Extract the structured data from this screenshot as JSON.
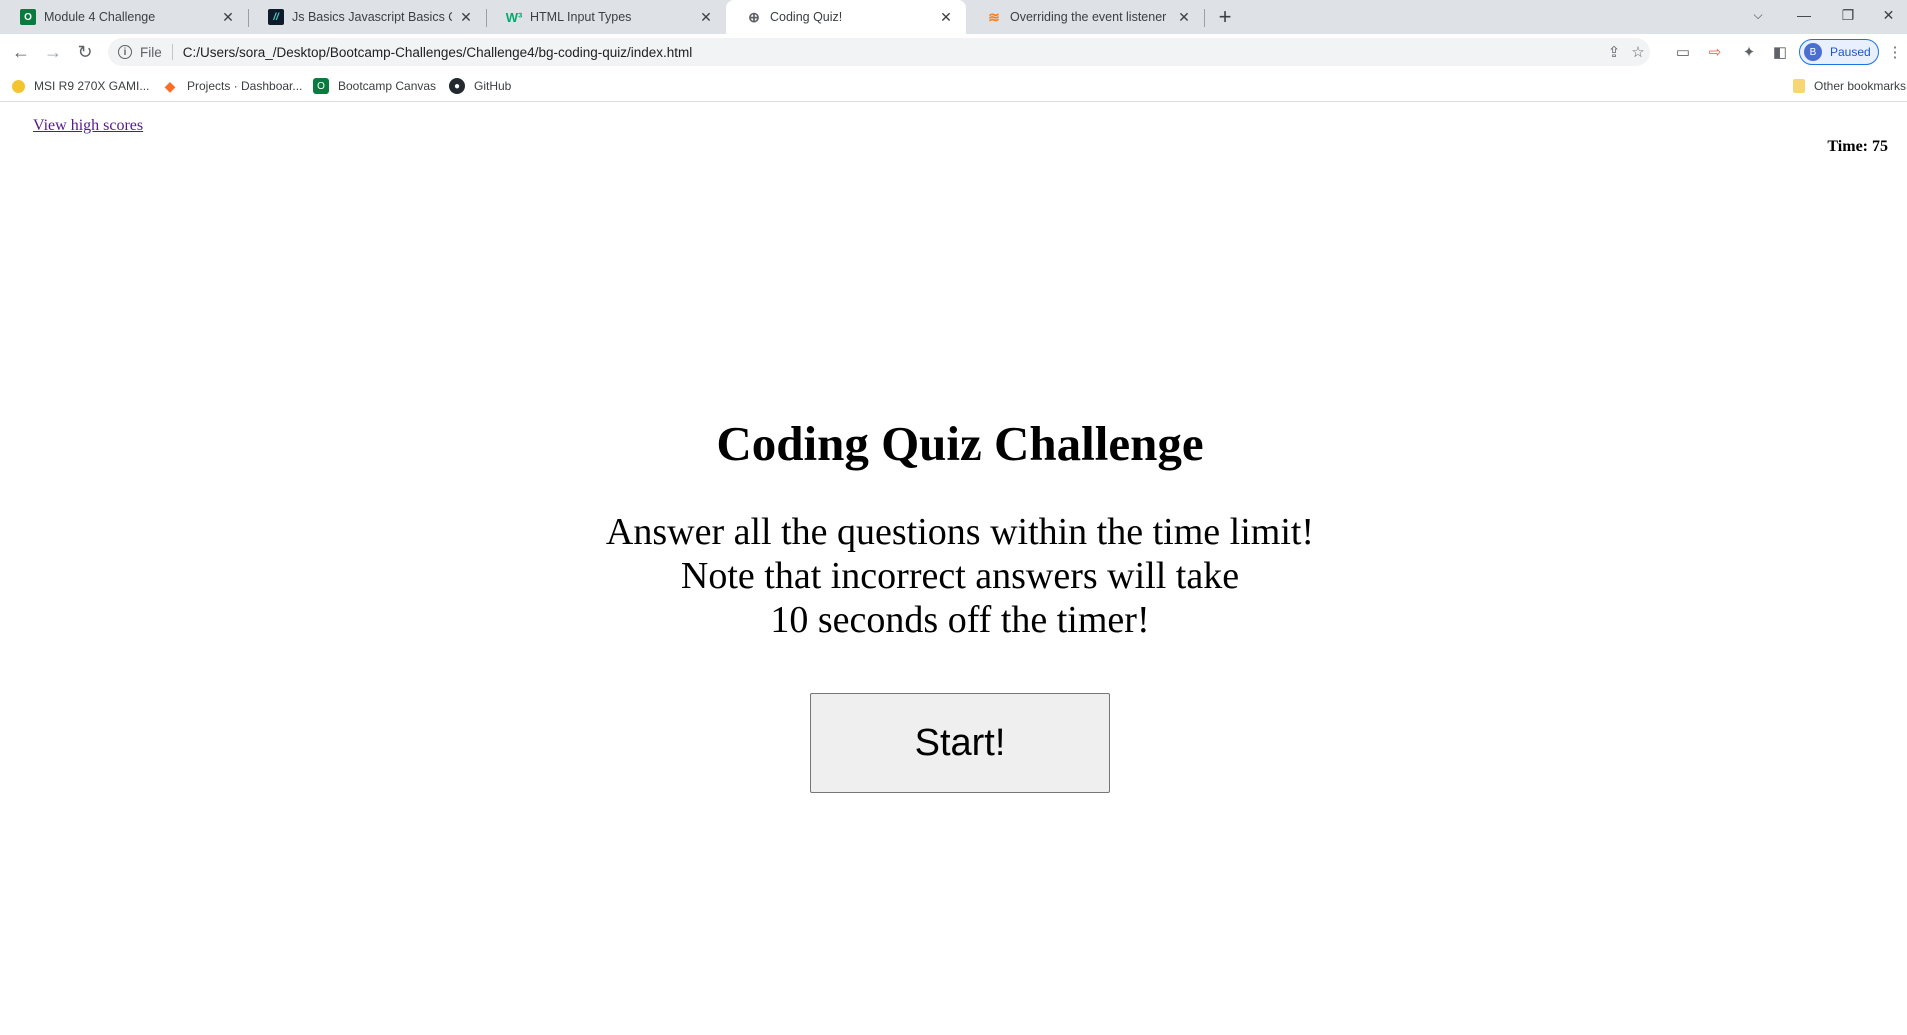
{
  "browser": {
    "tabs": [
      {
        "title": "Module 4 Challenge",
        "icon": "canvas-icon",
        "active": false
      },
      {
        "title": "Js Basics Javascript Basics Quiz -",
        "icon": "quiz-icon",
        "active": false
      },
      {
        "title": "HTML Input Types",
        "icon": "w3schools-icon",
        "active": false
      },
      {
        "title": "Coding Quiz!",
        "icon": "globe-icon",
        "active": true
      },
      {
        "title": "Overriding the event listener in ja",
        "icon": "stackoverflow-icon",
        "active": false
      }
    ],
    "address": {
      "scheme": "File",
      "url": "C:/Users/sora_/Desktop/Bootcamp-Challenges/Challenge4/bg-coding-quiz/index.html"
    },
    "profile": {
      "initial": "B",
      "status": "Paused"
    },
    "bookmarks": [
      {
        "label": "MSI R9 270X GAMI...",
        "icon": "msi-icon"
      },
      {
        "label": "Projects · Dashboar...",
        "icon": "gitlab-icon"
      },
      {
        "label": "Bootcamp Canvas",
        "icon": "canvas-icon"
      },
      {
        "label": "GitHub",
        "icon": "github-icon"
      }
    ],
    "other_bookmarks": "Other bookmarks"
  },
  "page": {
    "high_scores_link": "View high scores",
    "timer": "Time: 75",
    "heading": "Coding Quiz Challenge",
    "intro_lines": [
      "Answer all the questions within the time limit!",
      "Note that incorrect answers will take",
      "10 seconds off the timer!"
    ],
    "start_button": "Start!"
  },
  "colors": {
    "tabstrip_bg": "#dee1e6",
    "link_visited": "#551a8b",
    "button_bg": "#efefef",
    "profile_accent": "#1a73e8"
  }
}
